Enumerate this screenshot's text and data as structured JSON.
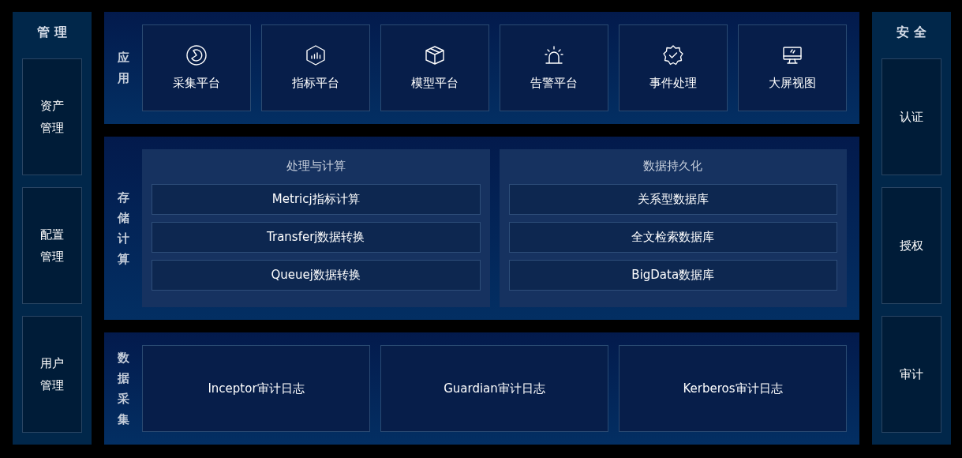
{
  "management": {
    "title": "管理",
    "items": [
      "资产管理",
      "配置管理",
      "用户管理"
    ]
  },
  "application": {
    "label": "应用",
    "items": [
      "采集平台",
      "指标平台",
      "模型平台",
      "告警平台",
      "事件处理",
      "大屏视图"
    ]
  },
  "storage": {
    "label": "存储计算",
    "groups": [
      {
        "title": "处理与计算",
        "items": [
          "Metricj指标计算",
          "Transferj数据转换",
          "Queuej数据转换"
        ]
      },
      {
        "title": "数据持久化",
        "items": [
          "关系型数据库",
          "全文检索数据库",
          "BigData数据库"
        ]
      }
    ]
  },
  "collection": {
    "label": "数据采集",
    "items": [
      "Inceptor审计日志",
      "Guardian审计日志",
      "Kerberos审计日志"
    ]
  },
  "security": {
    "title": "安全",
    "items": [
      "认证",
      "授权",
      "审计"
    ]
  }
}
